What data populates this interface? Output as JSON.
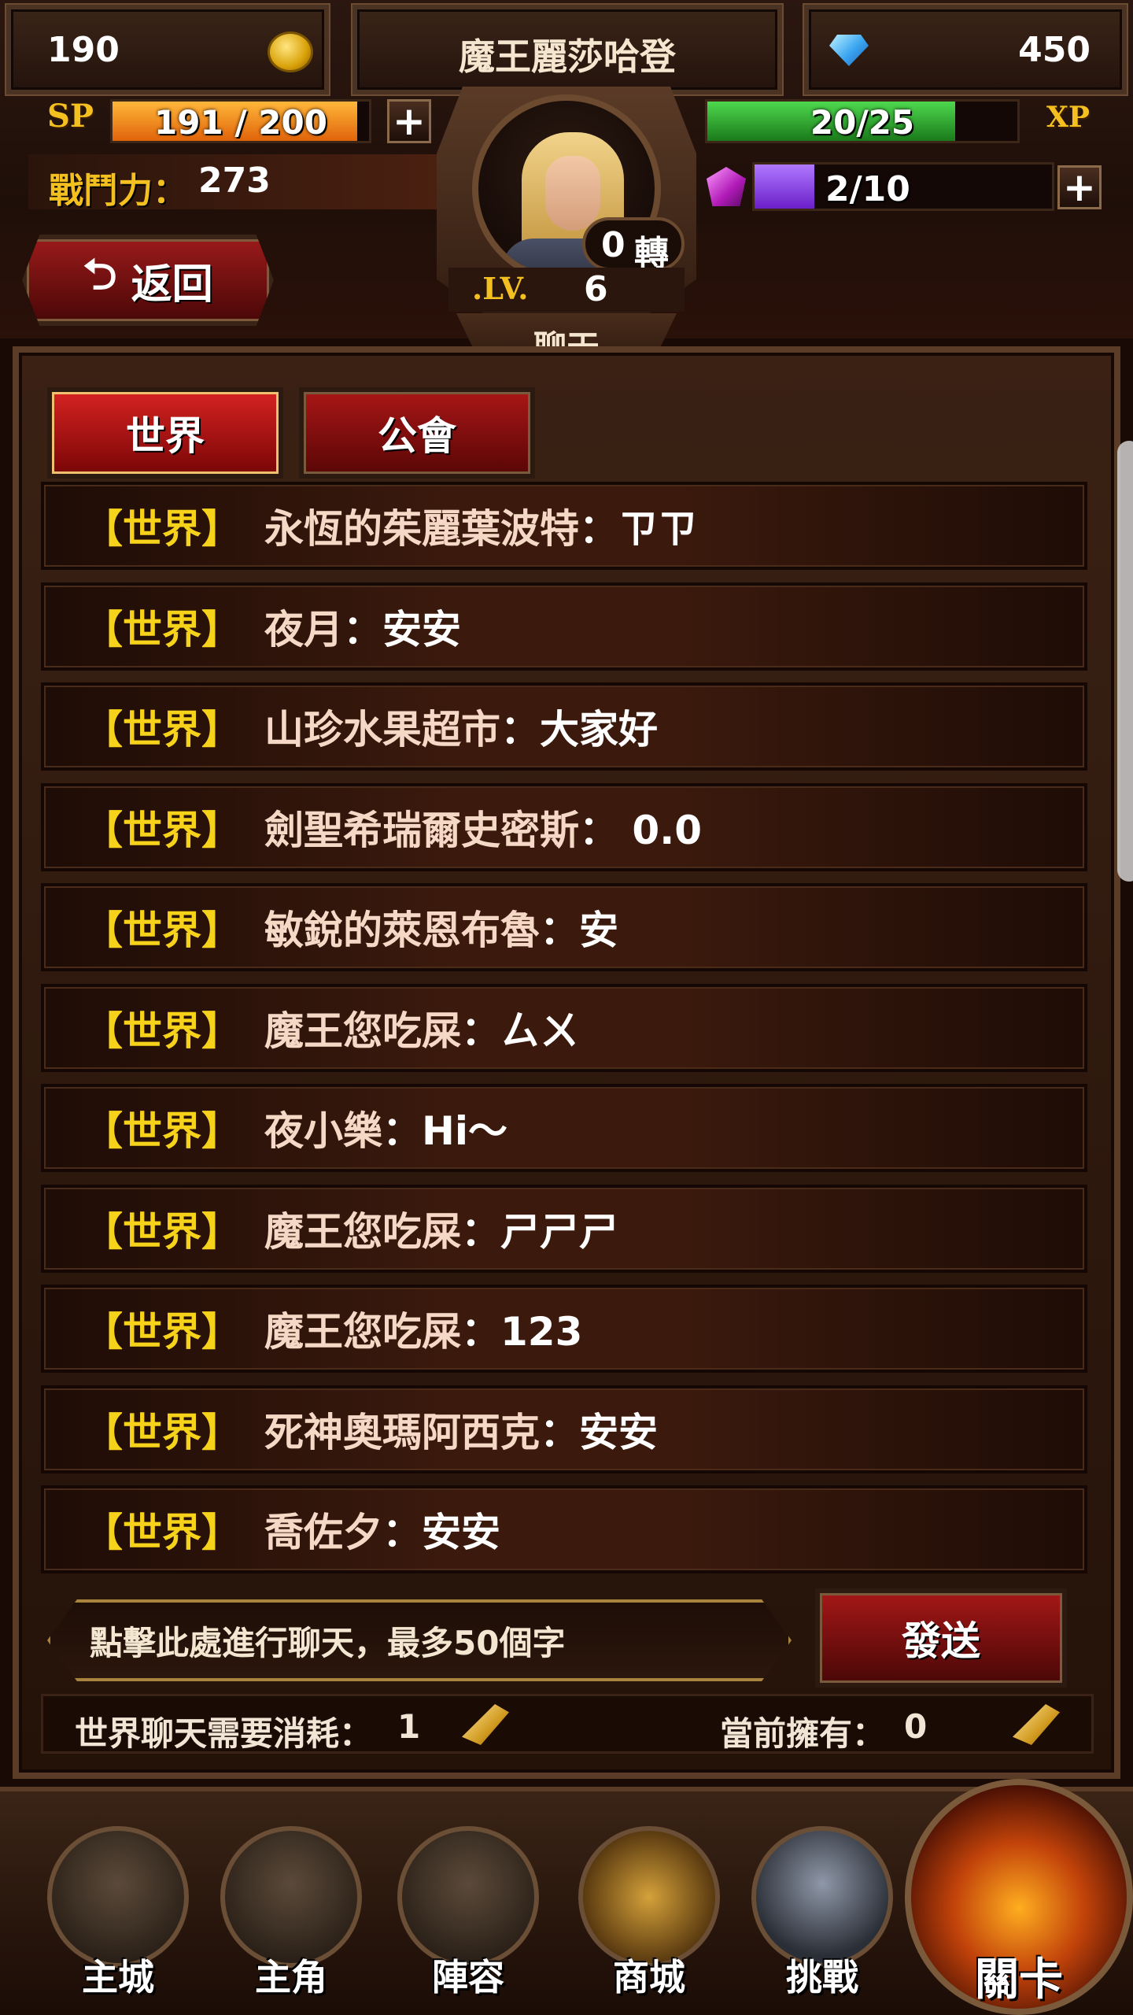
{
  "top_bar": {
    "gold": "190",
    "player_name": "魔王麗莎哈登",
    "diamonds": "450"
  },
  "stats": {
    "sp_label": "SP",
    "sp_value": "191 / 200",
    "sp_fraction": 0.955,
    "xp_label": "XP",
    "xp_value": "20/25",
    "xp_fraction": 0.8,
    "combat_power_label": "戰鬥力：",
    "combat_power": "273",
    "gem_value": "2/10",
    "gem_fraction": 0.2,
    "plus": "+"
  },
  "portrait": {
    "rebirth_count": "0",
    "rebirth_label": "轉",
    "level_label": ".LV.",
    "level": "6",
    "section_title": "聊天"
  },
  "back_button": {
    "label": "返回"
  },
  "tabs": [
    {
      "label": "世界",
      "active": true
    },
    {
      "label": "公會",
      "active": false
    }
  ],
  "chat_messages": [
    {
      "tag": "【世界】",
      "name": "永恆的茱麗葉波特",
      "message": "：ㄗㄗ"
    },
    {
      "tag": "【世界】",
      "name": "夜月",
      "message": "：安安"
    },
    {
      "tag": "【世界】",
      "name": "山珍水果超市",
      "message": "：大家好"
    },
    {
      "tag": "【世界】",
      "name": "劍聖希瑞爾史密斯",
      "message": "： 0.0"
    },
    {
      "tag": "【世界】",
      "name": "敏銳的萊恩布魯",
      "message": "：安"
    },
    {
      "tag": "【世界】",
      "name": "魔王您吃屎",
      "message": "：ㄙㄨ"
    },
    {
      "tag": "【世界】",
      "name": "夜小樂",
      "message": "：Hi～"
    },
    {
      "tag": "【世界】",
      "name": "魔王您吃屎",
      "message": "：ㄕㄕㄕ"
    },
    {
      "tag": "【世界】",
      "name": "魔王您吃屎",
      "message": "：123"
    },
    {
      "tag": "【世界】",
      "name": "死神奧瑪阿西克",
      "message": "：安安"
    },
    {
      "tag": "【世界】",
      "name": "喬佐夕",
      "message": "：安安"
    }
  ],
  "input": {
    "placeholder": "點擊此處進行聊天，最多50個字",
    "send_label": "發送"
  },
  "cost": {
    "cost_label": "世界聊天需要消耗：",
    "cost_value": "1",
    "owned_label": "當前擁有：",
    "owned_value": "0"
  },
  "nav": [
    {
      "label": "主城",
      "icon": "castle-icon"
    },
    {
      "label": "主角",
      "icon": "hero-icon"
    },
    {
      "label": "陣容",
      "icon": "formation-icon"
    },
    {
      "label": "商城",
      "icon": "treasure-chest-icon"
    },
    {
      "label": "挑戰",
      "icon": "crossed-swords-icon"
    },
    {
      "label": "關卡",
      "icon": "stage-icon"
    }
  ],
  "colors": {
    "world_tag": "#f7d21a",
    "sp_bar": "#f08a10",
    "xp_bar": "#2fa82f",
    "gem_bar": "#8a3bd8"
  }
}
